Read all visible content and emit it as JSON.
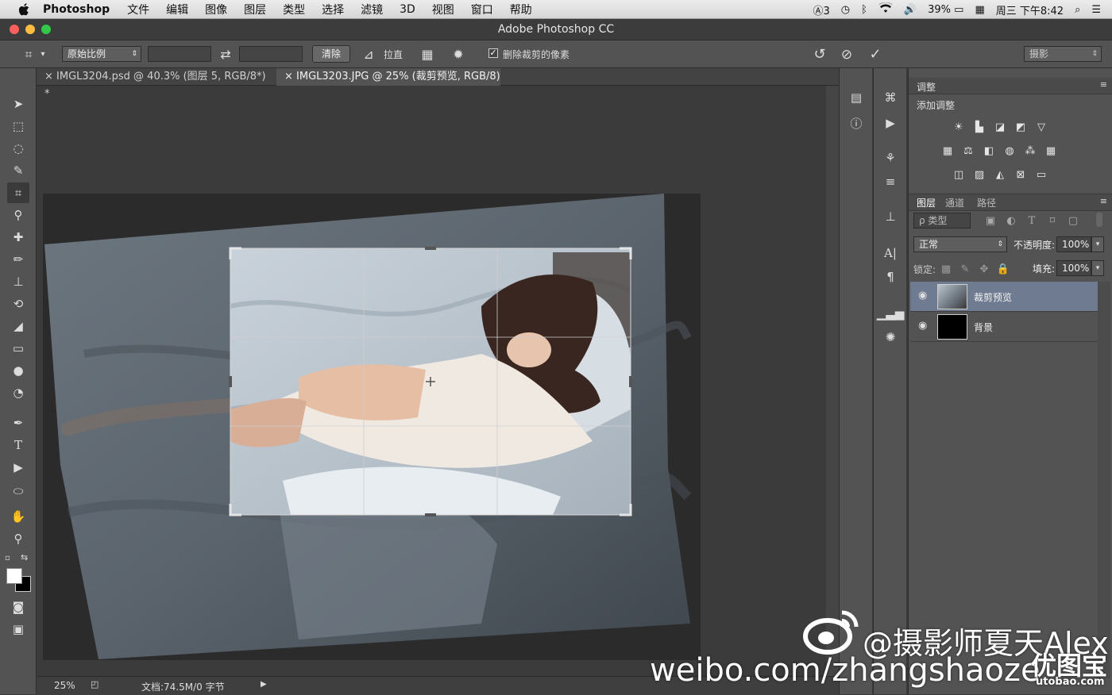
{
  "menubar": {
    "app_name": "Photoshop",
    "items": [
      "文件",
      "编辑",
      "图像",
      "图层",
      "类型",
      "选择",
      "滤镜",
      "3D",
      "视图",
      "窗口",
      "帮助"
    ],
    "status": {
      "adobe": "3",
      "battery": "39%",
      "datetime": "周三 下午8:42"
    }
  },
  "window": {
    "title": "Adobe Photoshop CC"
  },
  "options": {
    "ratio_select": "原始比例",
    "clear_label": "清除",
    "straighten_label": "拉直",
    "delete_cropped_label": "删除裁剪的像素",
    "workspace_select": "摄影"
  },
  "tabs": [
    {
      "label": "IMGL3204.psd @ 40.3% (图层 5, RGB/8*) *"
    },
    {
      "label": "IMGL3203.JPG @ 25% (裁剪预览, RGB/8)"
    }
  ],
  "status": {
    "zoom": "25%",
    "doc": "文档:74.5M/0 字节"
  },
  "adjustments": {
    "tab": "调整",
    "add_label": "添加调整"
  },
  "layers_panel": {
    "tabs": [
      "图层",
      "通道",
      "路径"
    ],
    "filter_kind": "ρ 类型",
    "blend_mode": "正常",
    "opacity_label": "不透明度:",
    "opacity_value": "100%",
    "lock_label": "锁定:",
    "fill_label": "填充:",
    "fill_value": "100%",
    "layers": [
      {
        "name": "裁剪预览"
      },
      {
        "name": "背景"
      }
    ]
  },
  "watermark": {
    "line1": "@摄影师夏天Alex",
    "line2": "weibo.com/zhangshaoze",
    "logo": "优图宝",
    "logo_url": "utobao.com"
  }
}
